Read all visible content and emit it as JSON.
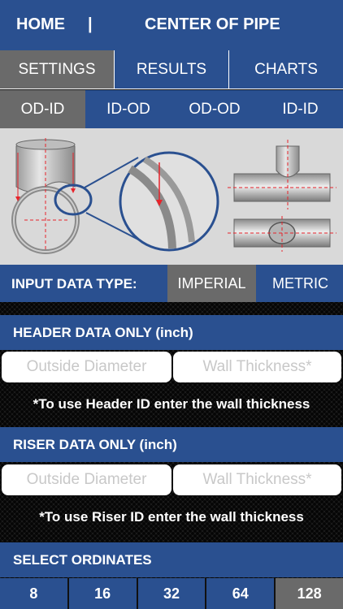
{
  "header": {
    "home_label": "HOME",
    "separator": "|",
    "title": "CENTER OF PIPE"
  },
  "tabs": [
    {
      "label": "SETTINGS",
      "active": true
    },
    {
      "label": "RESULTS",
      "active": false
    },
    {
      "label": "CHARTS",
      "active": false
    }
  ],
  "modes": [
    {
      "label": "OD-ID",
      "active": true
    },
    {
      "label": "ID-OD",
      "active": false
    },
    {
      "label": "OD-OD",
      "active": false
    },
    {
      "label": "ID-ID",
      "active": false
    }
  ],
  "input_type": {
    "label": "INPUT DATA TYPE:",
    "options": [
      {
        "label": "IMPERIAL",
        "active": true
      },
      {
        "label": "METRIC",
        "active": false
      }
    ]
  },
  "header_data": {
    "title": "HEADER DATA ONLY (inch)",
    "od_placeholder": "Outside Diameter",
    "wall_placeholder": "Wall Thickness*",
    "note": "*To use Header ID enter the wall thickness"
  },
  "riser_data": {
    "title": "RISER DATA ONLY (inch)",
    "od_placeholder": "Outside Diameter",
    "wall_placeholder": "Wall Thickness*",
    "note": "*To use Riser ID enter the wall thickness"
  },
  "ordinates": {
    "title": "SELECT ORDINATES",
    "options": [
      {
        "label": "8",
        "active": false
      },
      {
        "label": "16",
        "active": false
      },
      {
        "label": "32",
        "active": false
      },
      {
        "label": "64",
        "active": false
      },
      {
        "label": "128",
        "active": true
      }
    ]
  },
  "colors": {
    "primary": "#2a5090",
    "selected": "#6a6a6a",
    "diagram_bg": "#d9d9d9",
    "marker": "#e8232a"
  }
}
